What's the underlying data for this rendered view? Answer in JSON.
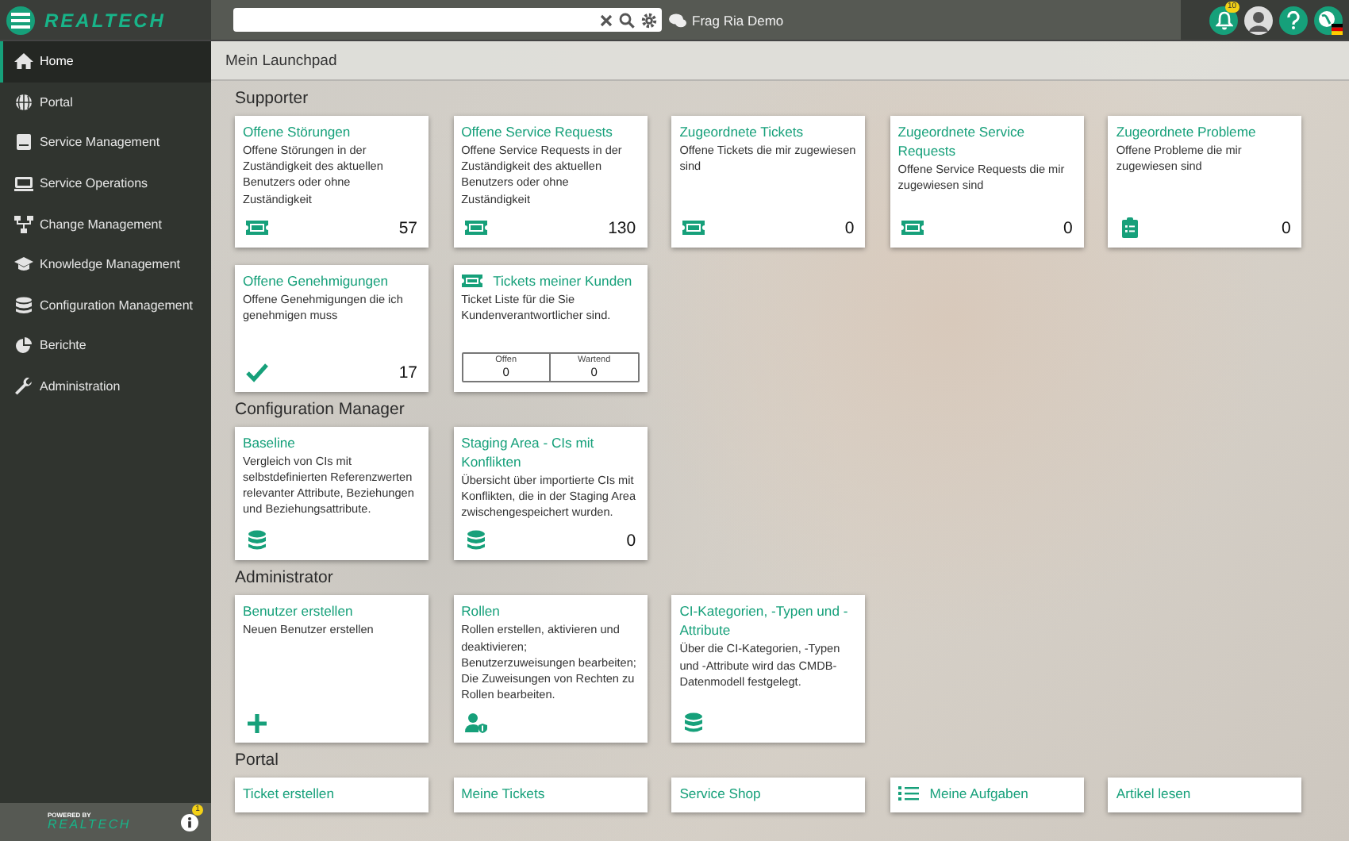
{
  "topbar": {
    "logo": "REALTECH",
    "chat_label": "Frag Ria Demo",
    "notification_count": "10"
  },
  "sidebar": {
    "items": [
      {
        "label": "Home",
        "selected": true
      },
      {
        "label": "Portal",
        "selected": false
      },
      {
        "label": "Service Management",
        "selected": false
      },
      {
        "label": "Service Operations",
        "selected": false
      },
      {
        "label": "Change Management",
        "selected": false
      },
      {
        "label": "Knowledge Management",
        "selected": false
      },
      {
        "label": "Configuration Management",
        "selected": false
      },
      {
        "label": "Berichte",
        "selected": false
      },
      {
        "label": "Administration",
        "selected": false
      }
    ],
    "footer": {
      "powered_by": "POWERED BY",
      "logo": "REALTECH",
      "info_count": "1"
    }
  },
  "page_title": "Mein Launchpad",
  "sections": [
    {
      "title": "Supporter",
      "tiles": [
        {
          "kind": "count",
          "title": "Offene Störungen",
          "description": "Offene Störungen in der Zuständigkeit des aktuellen Benutzers oder ohne Zuständigkeit",
          "count": "57"
        },
        {
          "kind": "count",
          "title": "Offene Service Requests",
          "description": "Offene Service Requests in der Zuständigkeit des aktuellen Benutzers oder ohne Zuständigkeit",
          "count": "130"
        },
        {
          "kind": "count",
          "title": "Zugeordnete Tickets",
          "description": "Offene Tickets die mir zugewiesen sind",
          "count": "0"
        },
        {
          "kind": "count",
          "title": "Zugeordnete Service Requests",
          "description": "Offene Service Requests die mir zugewiesen sind",
          "count": "0"
        },
        {
          "kind": "count",
          "title": "Zugeordnete Probleme",
          "description": "Offene Probleme die mir zugewiesen sind",
          "count": "0"
        },
        {
          "kind": "count",
          "title": "Offene Genehmigungen",
          "description": "Offene Genehmigungen die ich genehmigen muss",
          "count": "17"
        },
        {
          "kind": "table",
          "title": "Tickets meiner Kunden",
          "description": "Ticket Liste für die Sie Kundenverantwortlicher sind.",
          "stats": [
            {
              "label": "Offen",
              "value": "0"
            },
            {
              "label": "Wartend",
              "value": "0"
            }
          ]
        }
      ]
    },
    {
      "title": "Configuration Manager",
      "tiles": [
        {
          "kind": "count",
          "title": "Baseline",
          "description": "Vergleich von CIs mit selbstdefinierten Referenzwerten relevanter Attribute, Beziehungen und Beziehungsattribute."
        },
        {
          "kind": "count",
          "title": "Staging Area - CIs mit Konflikten",
          "description": "Übersicht über importierte CIs mit Konflikten, die in der Staging Area zwischengespeichert wurden.",
          "count": "0"
        }
      ]
    },
    {
      "title": "Administrator",
      "tiles": [
        {
          "kind": "count",
          "title": "Benutzer erstellen",
          "description": "Neuen Benutzer erstellen"
        },
        {
          "kind": "count",
          "title": "Rollen",
          "description": "Rollen erstellen, aktivieren und deaktivieren; Benutzerzuweisungen bearbeiten; Die Zuweisungen von Rechten zu Rollen bearbeiten."
        },
        {
          "kind": "count",
          "title": "CI-Kategorien, -Typen und -Attribute",
          "description": "Über die CI-Kategorien, -Typen und -Attribute wird das CMDB-Datenmodell festgelegt."
        }
      ]
    },
    {
      "title": "Portal",
      "tiles": [
        {
          "kind": "link",
          "title": "Ticket erstellen"
        },
        {
          "kind": "link",
          "title": "Meine Tickets"
        },
        {
          "kind": "link",
          "title": "Service Shop"
        },
        {
          "kind": "link",
          "title": "Meine Aufgaben"
        },
        {
          "kind": "link",
          "title": "Artikel lesen"
        }
      ]
    }
  ]
}
